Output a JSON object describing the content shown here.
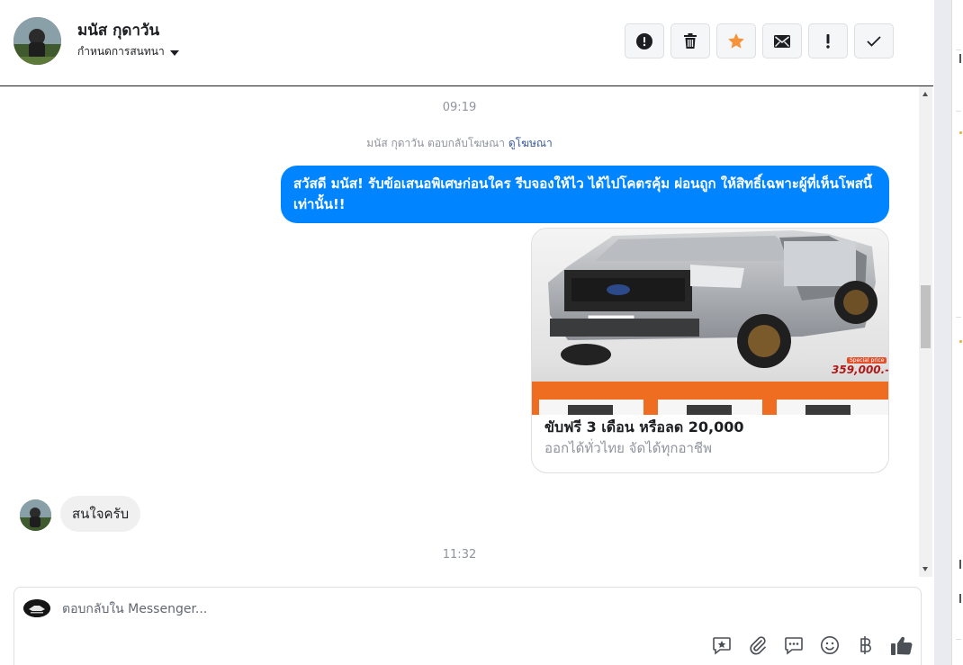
{
  "header": {
    "contact_name": "มนัส กุดาวัน",
    "assign_label": "กำหนดการสนทนา",
    "toolbar": [
      {
        "name": "spam-button",
        "icon": "alert-circle-icon"
      },
      {
        "name": "delete-button",
        "icon": "trash-icon"
      },
      {
        "name": "star-button",
        "icon": "star-icon"
      },
      {
        "name": "mark-unread-button",
        "icon": "envelope-icon"
      },
      {
        "name": "follow-up-button",
        "icon": "exclamation-icon"
      },
      {
        "name": "mark-done-button",
        "icon": "check-icon"
      }
    ]
  },
  "conversation": {
    "timestamp_1": "09:19",
    "reply_note": "มนัส กุดาวัน ตอบกลับโฆษณา",
    "reply_note_link": "ดูโฆษณา",
    "outgoing_message": "สวัสดี มนัส! รับข้อเสนอพิเศษก่อนใคร รีบจองให้ไว ได้ไปโคตรคุ้ม ผ่อนถูก ให้สิทธิ์เฉพาะผู้ที่เห็นโพสนี้เท่านั้น!!",
    "ad_card": {
      "title": "ขับฟรี 3 เดือน หรือลด 20,000",
      "subtitle": "ออกได้ทั่วไทย จัดได้ทุกอาชีพ",
      "image_badge": "Special price",
      "image_price": "359,000.-"
    },
    "incoming_message": "สนใจครับ",
    "timestamp_2": "11:32"
  },
  "composer": {
    "placeholder": "ตอบกลับใน Messenger...",
    "tools": [
      "saved-reply-icon",
      "attachment-icon",
      "chat-bubble-icon",
      "emoji-icon",
      "baht-icon",
      "thumbs-up-icon"
    ]
  },
  "colors": {
    "accent": "#0084ff",
    "star": "#f7923b",
    "link": "#385898"
  }
}
